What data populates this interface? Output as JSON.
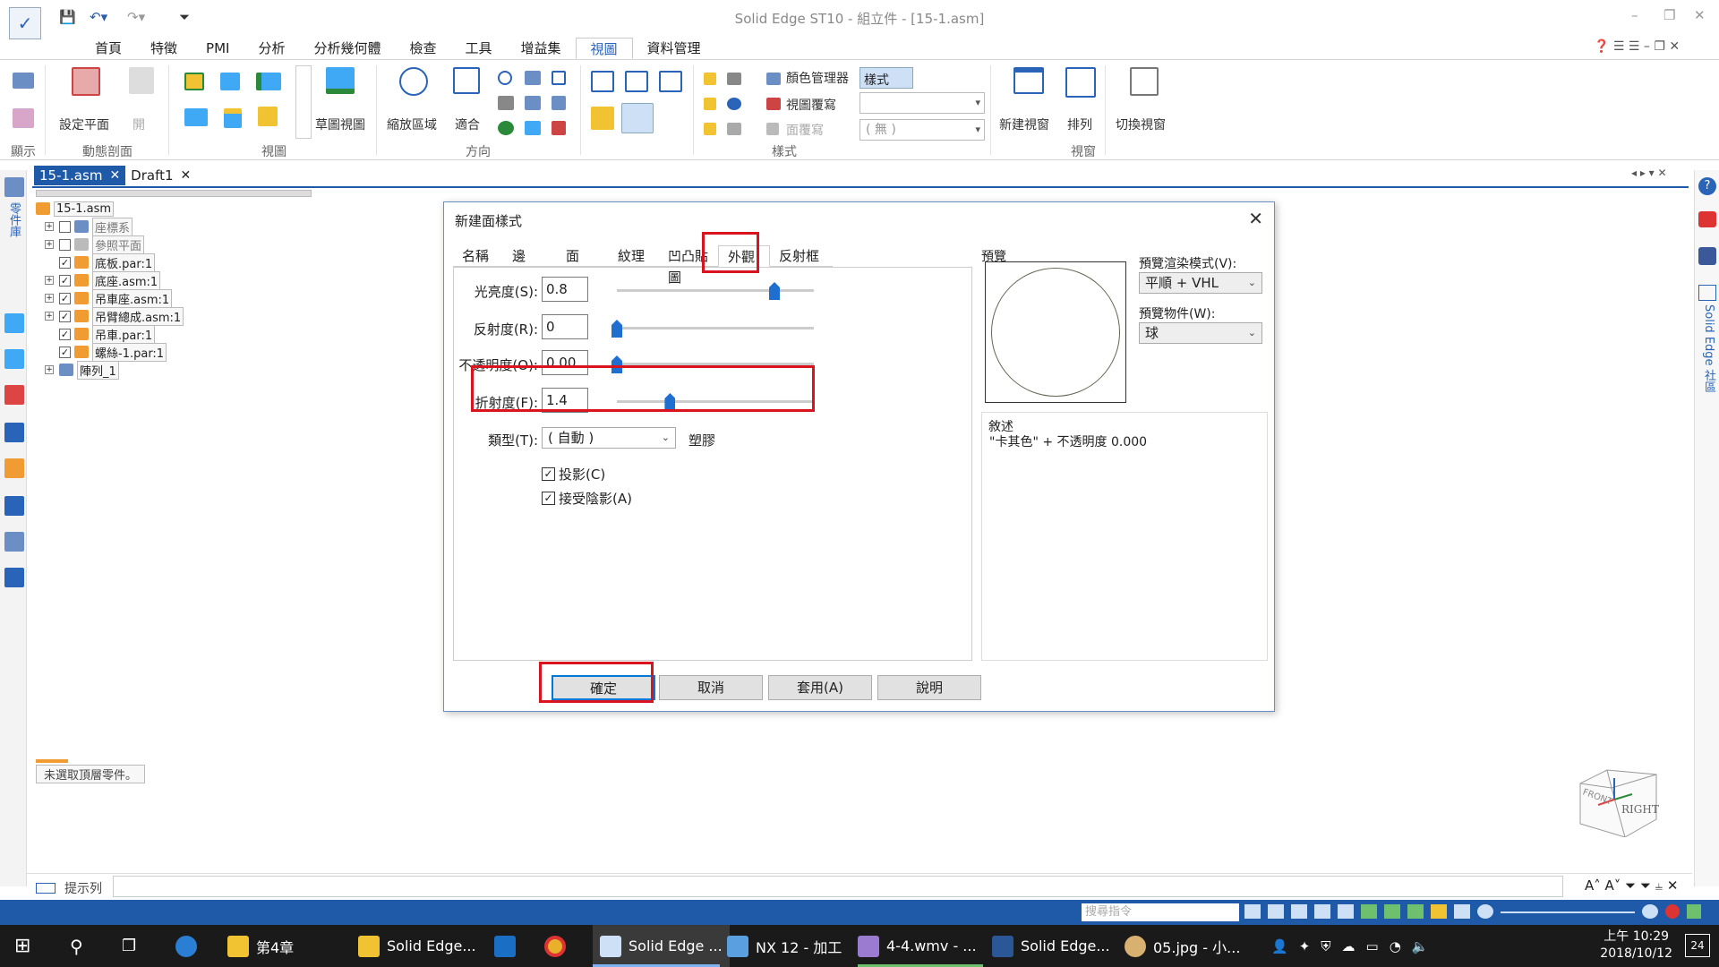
{
  "window": {
    "title": "Solid Edge ST10 - 組立件 - [15-1.asm]"
  },
  "ribbon": {
    "tabs": [
      "首頁",
      "特徵",
      "PMI",
      "分析",
      "分析幾何體",
      "檢查",
      "工具",
      "增益集",
      "視圖",
      "資料管理"
    ],
    "active_tab": "視圖",
    "groups": {
      "show": "顯示",
      "dynamic_section": "動態剖面",
      "views": "視圖",
      "orient": "方向",
      "style": "樣式",
      "window": "視窗"
    },
    "buttons": {
      "set_plane": "設定平面",
      "open": "開",
      "sketch_view": "草圖視圖",
      "zoom_area": "縮放區域",
      "fit": "適合",
      "color_manager": "顏色管理器",
      "view_overrides": "視圖覆寫",
      "face_override": "面覆寫",
      "styles": "樣式",
      "style_none": "( 無 )",
      "new_window": "新建視窗",
      "arrange": "排列",
      "switch_window": "切換視窗"
    }
  },
  "doc_tabs": [
    {
      "label": "15-1.asm",
      "active": true
    },
    {
      "label": "Draft1",
      "active": false
    }
  ],
  "left_panel": {
    "vertical_title": "零件庫"
  },
  "tree": {
    "root": "15-1.asm",
    "nodes": [
      {
        "label": "座標系",
        "checked": false,
        "dim": true
      },
      {
        "label": "參照平面",
        "checked": false,
        "dim": true
      },
      {
        "label": "底板.par:1",
        "checked": true
      },
      {
        "label": "底座.asm:1",
        "checked": true
      },
      {
        "label": "吊車座.asm:1",
        "checked": true
      },
      {
        "label": "吊臂總成.asm:1",
        "checked": true
      },
      {
        "label": "吊車.par:1",
        "checked": true
      },
      {
        "label": "螺絲-1.par:1",
        "checked": true
      },
      {
        "label": "陣列_1",
        "checked": false
      }
    ],
    "status": "未選取頂層零件。"
  },
  "dialog": {
    "title": "新建面樣式",
    "tabs": [
      "名稱",
      "邊",
      "面",
      "紋理",
      "凹凸貼圖",
      "外觀",
      "反射框"
    ],
    "active_tab": "外觀",
    "fields": {
      "shininess": {
        "label": "光亮度(S):",
        "value": "0.8",
        "slider": 0.8
      },
      "reflectivity": {
        "label": "反射度(R):",
        "value": "0",
        "slider": 0.0
      },
      "opacity": {
        "label": "不透明度(O):",
        "value": "0.00",
        "slider": 0.0
      },
      "refraction": {
        "label": "折射度(F):",
        "value": "1.4",
        "slider": 0.27
      }
    },
    "type": {
      "label": "類型(T):",
      "value": "( 自動 )",
      "suffix": "塑膠"
    },
    "cast_shadow": {
      "label": "投影(C)",
      "checked": true
    },
    "accept_shadow": {
      "label": "接受陰影(A)",
      "checked": true
    },
    "preview": {
      "label": "預覽",
      "render_mode_label": "預覽渲染模式(V):",
      "render_mode_value": "平順 + VHL",
      "object_label": "預覽物件(W):",
      "object_value": "球"
    },
    "description": {
      "label": "敘述",
      "text": "\"卡其色\" + 不透明度 0.000"
    },
    "buttons": {
      "ok": "確定",
      "cancel": "取消",
      "apply": "套用(A)",
      "help": "說明"
    }
  },
  "right_panel": {
    "vertical_title": "Solid Edge 社區"
  },
  "viewcube": {
    "front": "FRONT",
    "right": "RIGHT"
  },
  "command_bar": {
    "prompt_label": "提示列",
    "search_placeholder": "搜尋指令"
  },
  "taskbar": {
    "items": [
      {
        "label": "第4章"
      },
      {
        "label": "Solid Edge..."
      },
      {
        "label": "Solid Edge ..."
      },
      {
        "label": "NX 12 - 加工"
      },
      {
        "label": "4-4.wmv - ..."
      },
      {
        "label": "Solid Edge..."
      },
      {
        "label": "05.jpg - 小..."
      }
    ],
    "time": "上午 10:29",
    "date": "2018/10/12",
    "notifications": "24"
  },
  "colors": {
    "accent": "#1e5aa8",
    "highlight_red": "#d9141e",
    "slider_blue": "#1e6fd0"
  }
}
